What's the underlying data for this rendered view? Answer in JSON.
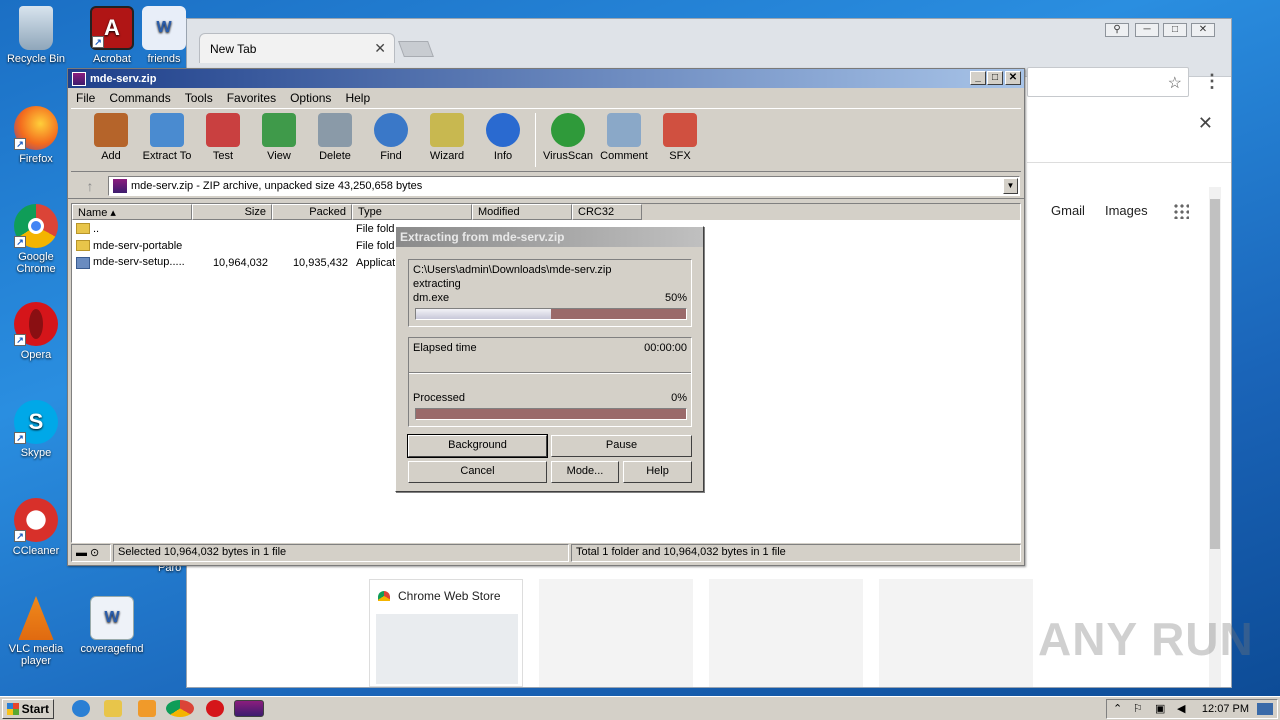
{
  "desktop": {
    "icons": [
      {
        "label": "Recycle Bin"
      },
      {
        "label": "Acrobat"
      },
      {
        "label": "friends"
      },
      {
        "label": "Firefox"
      },
      {
        "label": "Google Chrome"
      },
      {
        "label": "Opera"
      },
      {
        "label": "Skype"
      },
      {
        "label": "CCleaner"
      },
      {
        "label": "VLC media player"
      },
      {
        "label": "coveragefind"
      }
    ],
    "partial_label": "Paro"
  },
  "chrome": {
    "tab_title": "New Tab",
    "tab_close": "✕",
    "gmail": "Gmail",
    "images": "Images",
    "tile_title": "Chrome Web Store",
    "star": "☆",
    "kebab": "⋮",
    "infobar_close": "✕"
  },
  "winrar": {
    "title": "mde-serv.zip",
    "menu": [
      "File",
      "Commands",
      "Tools",
      "Favorites",
      "Options",
      "Help"
    ],
    "toolbar": [
      {
        "label": "Add",
        "icon": "add-icon",
        "color": "#b5642a"
      },
      {
        "label": "Extract To",
        "icon": "extract-folder-icon",
        "color": "#4a8bd0"
      },
      {
        "label": "Test",
        "icon": "test-checklist-icon",
        "color": "#c94040"
      },
      {
        "label": "View",
        "icon": "view-book-icon",
        "color": "#3f9a4a"
      },
      {
        "label": "Delete",
        "icon": "trash-icon",
        "color": "#8a9aa8"
      },
      {
        "label": "Find",
        "icon": "magnifier-icon",
        "color": "#3a78c8"
      },
      {
        "label": "Wizard",
        "icon": "wand-icon",
        "color": "#c8b850"
      },
      {
        "label": "Info",
        "icon": "info-icon",
        "color": "#2a6ad0"
      },
      {
        "label": "VirusScan",
        "icon": "virus-scan-icon",
        "color": "#2f9a3a"
      },
      {
        "label": "Comment",
        "icon": "comment-icon",
        "color": "#8aa8c8"
      },
      {
        "label": "SFX",
        "icon": "sfx-icon",
        "color": "#d05040"
      }
    ],
    "address": "mde-serv.zip - ZIP archive, unpacked size 43,250,658 bytes",
    "columns": [
      "Name",
      "Size",
      "Packed",
      "Type",
      "Modified",
      "CRC32"
    ],
    "rows": [
      {
        "name": "..",
        "size": "",
        "packed": "",
        "type": "File fold",
        "kind": "folder"
      },
      {
        "name": "mde-serv-portable",
        "size": "",
        "packed": "",
        "type": "File fold",
        "kind": "folder"
      },
      {
        "name": "mde-serv-setup.....",
        "size": "10,964,032",
        "packed": "10,935,432",
        "type": "Applicat",
        "kind": "exe"
      }
    ],
    "status_left": "Selected 10,964,032 bytes in 1 file",
    "status_right": "Total 1 folder and 10,964,032 bytes in 1 file"
  },
  "extract_dialog": {
    "title": "Extracting from mde-serv.zip",
    "path": "C:\\Users\\admin\\Downloads\\mde-serv.zip",
    "action": "extracting",
    "file": "dm.exe",
    "file_percent": "50%",
    "file_progress": 0.5,
    "elapsed_label": "Elapsed time",
    "elapsed_value": "00:00:00",
    "processed_label": "Processed",
    "processed_percent": "0%",
    "processed_progress": 0.0,
    "buttons": {
      "background": "Background",
      "pause": "Pause",
      "cancel": "Cancel",
      "mode": "Mode...",
      "help": "Help"
    }
  },
  "taskbar": {
    "start": "Start",
    "clock": "12:07 PM"
  },
  "watermark": "ANY RUN"
}
